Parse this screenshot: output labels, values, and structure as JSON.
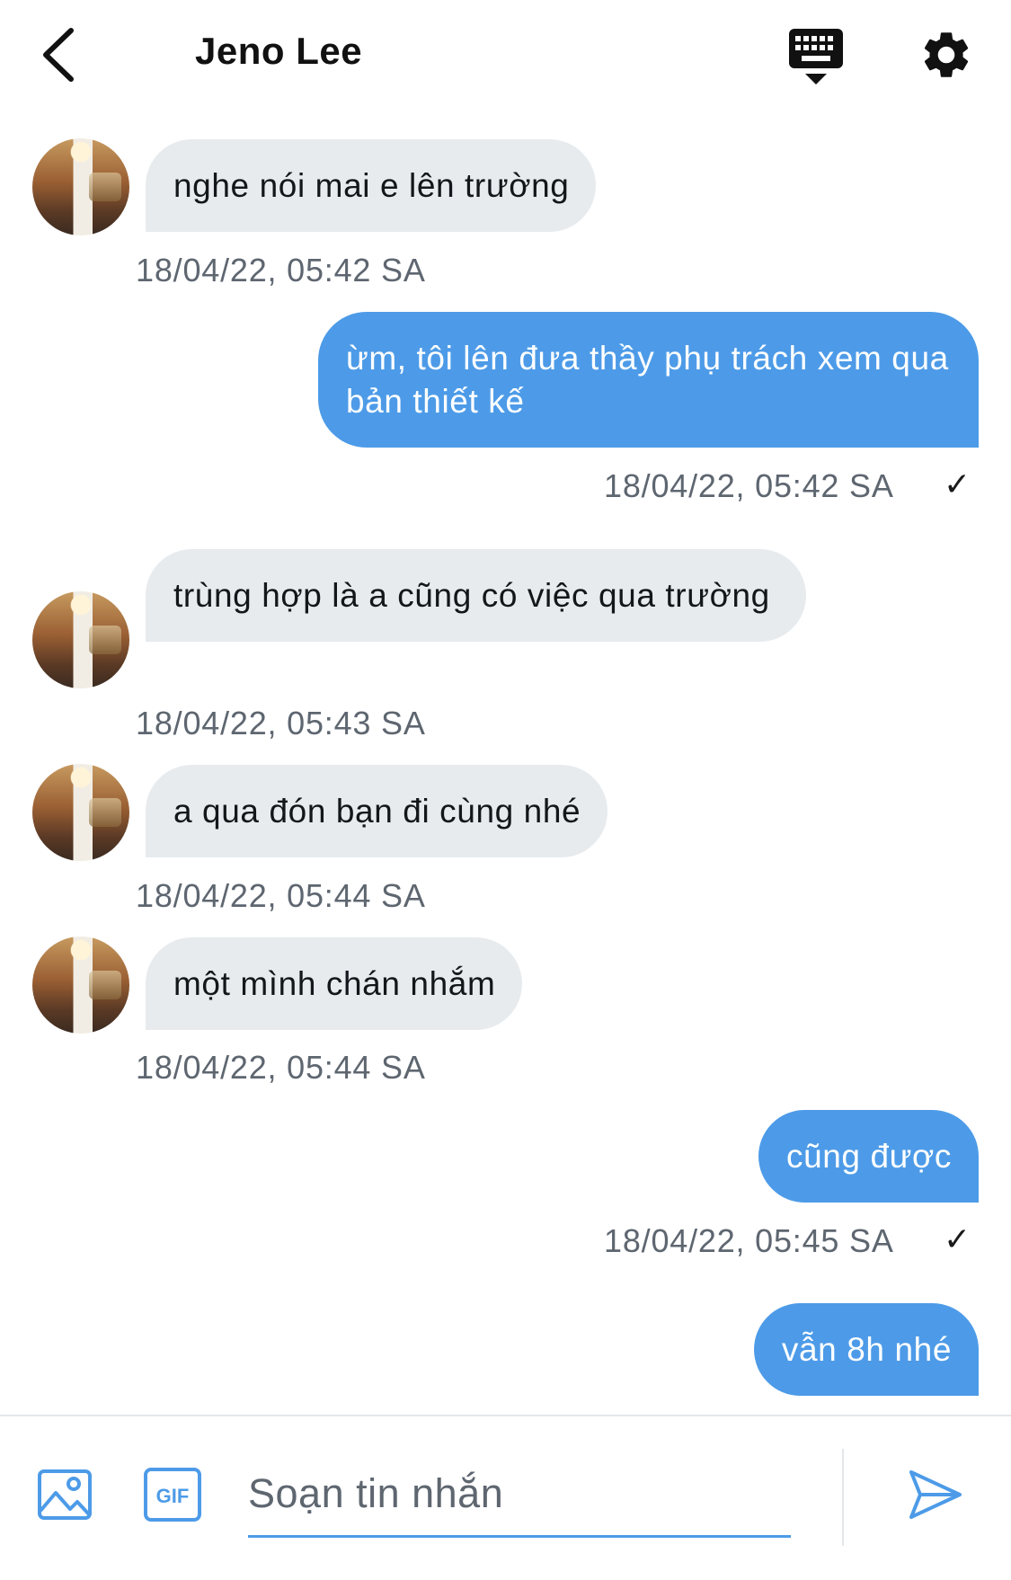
{
  "header": {
    "title": "Jeno Lee",
    "back_icon": "chevron-left-icon",
    "keyboard_icon": "keyboard-icon",
    "settings_icon": "gear-icon"
  },
  "messages": [
    {
      "side": "in",
      "text": "nghe nói mai e lên trường",
      "time": "18/04/22, 05:42 SA"
    },
    {
      "side": "out",
      "text": "ừm, tôi lên đưa thầy phụ trách xem qua bản thiết kế",
      "time": "18/04/22, 05:42 SA",
      "status": "✓"
    },
    {
      "side": "in",
      "text": "trùng hợp là a cũng có việc qua trường",
      "time": "18/04/22, 05:43 SA"
    },
    {
      "side": "in",
      "text": "a qua đón bạn đi cùng nhé",
      "time": "18/04/22, 05:44 SA"
    },
    {
      "side": "in",
      "text": "một mình chán nhắm",
      "time": "18/04/22, 05:44 SA"
    },
    {
      "side": "out",
      "text": "cũng được",
      "time": "18/04/22, 05:45 SA",
      "status": "✓"
    },
    {
      "side": "out",
      "text": "vẫn 8h nhé"
    }
  ],
  "composer": {
    "image_icon": "image-icon",
    "gif_icon": "gif-icon",
    "gif_label": "GIF",
    "placeholder": "Soạn tin nhắn",
    "value": "",
    "send_icon": "send-icon"
  },
  "colors": {
    "accent": "#4d9be8",
    "incoming_bubble": "#e7ebee",
    "timestamp": "#5e6670"
  }
}
